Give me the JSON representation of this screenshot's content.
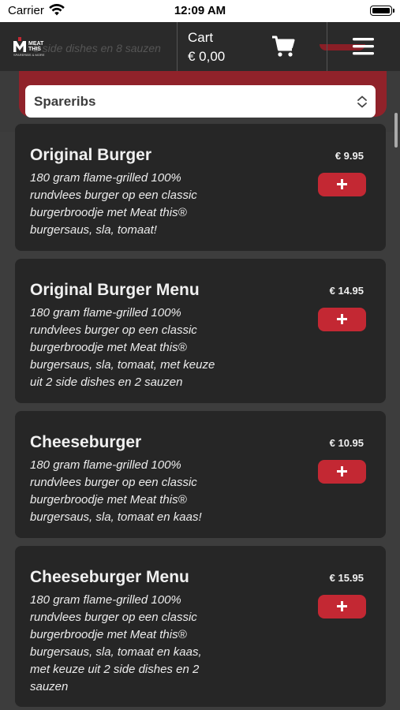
{
  "status_bar": {
    "carrier": "Carrier",
    "time": "12:09 AM"
  },
  "header": {
    "ghost_text": "8 side dishes en 8 sauzen",
    "logo_lines": [
      "MEAT",
      "THIS",
      "SPARERIBS & MORE"
    ],
    "cart_label": "Cart",
    "cart_total": "€ 0,00",
    "cart_icon": "shopping-cart-icon",
    "menu_icon": "hamburger-menu-icon"
  },
  "category": {
    "selected": "Spareribs",
    "icon": "chevron-up-down-icon"
  },
  "colors": {
    "accent": "#c32833",
    "card": "#262626",
    "background": "#3d3d3d"
  },
  "products": [
    {
      "name": "Original Burger",
      "price": "€ 9.95",
      "description": "180 gram flame-grilled 100% rundvlees burger op een classic burgerbroodje met Meat this® burgersaus, sla, tomaat!"
    },
    {
      "name": "Original Burger Menu",
      "price": "€ 14.95",
      "description": "180 gram flame-grilled 100% rundvlees burger op een classic burgerbroodje met Meat this® burgersaus, sla, tomaat, met keuze uit 2 side dishes en 2 sauzen"
    },
    {
      "name": "Cheeseburger",
      "price": "€ 10.95",
      "description": "180 gram flame-grilled 100% rundvlees burger op een classic burgerbroodje met Meat this® burgersaus, sla, tomaat en kaas!"
    },
    {
      "name": "Cheeseburger Menu",
      "price": "€ 15.95",
      "description": "180 gram flame-grilled 100% rundvlees burger op een classic burgerbroodje met Meat this® burgersaus, sla, tomaat en kaas, met keuze uit 2 side dishes en 2 sauzen"
    }
  ]
}
